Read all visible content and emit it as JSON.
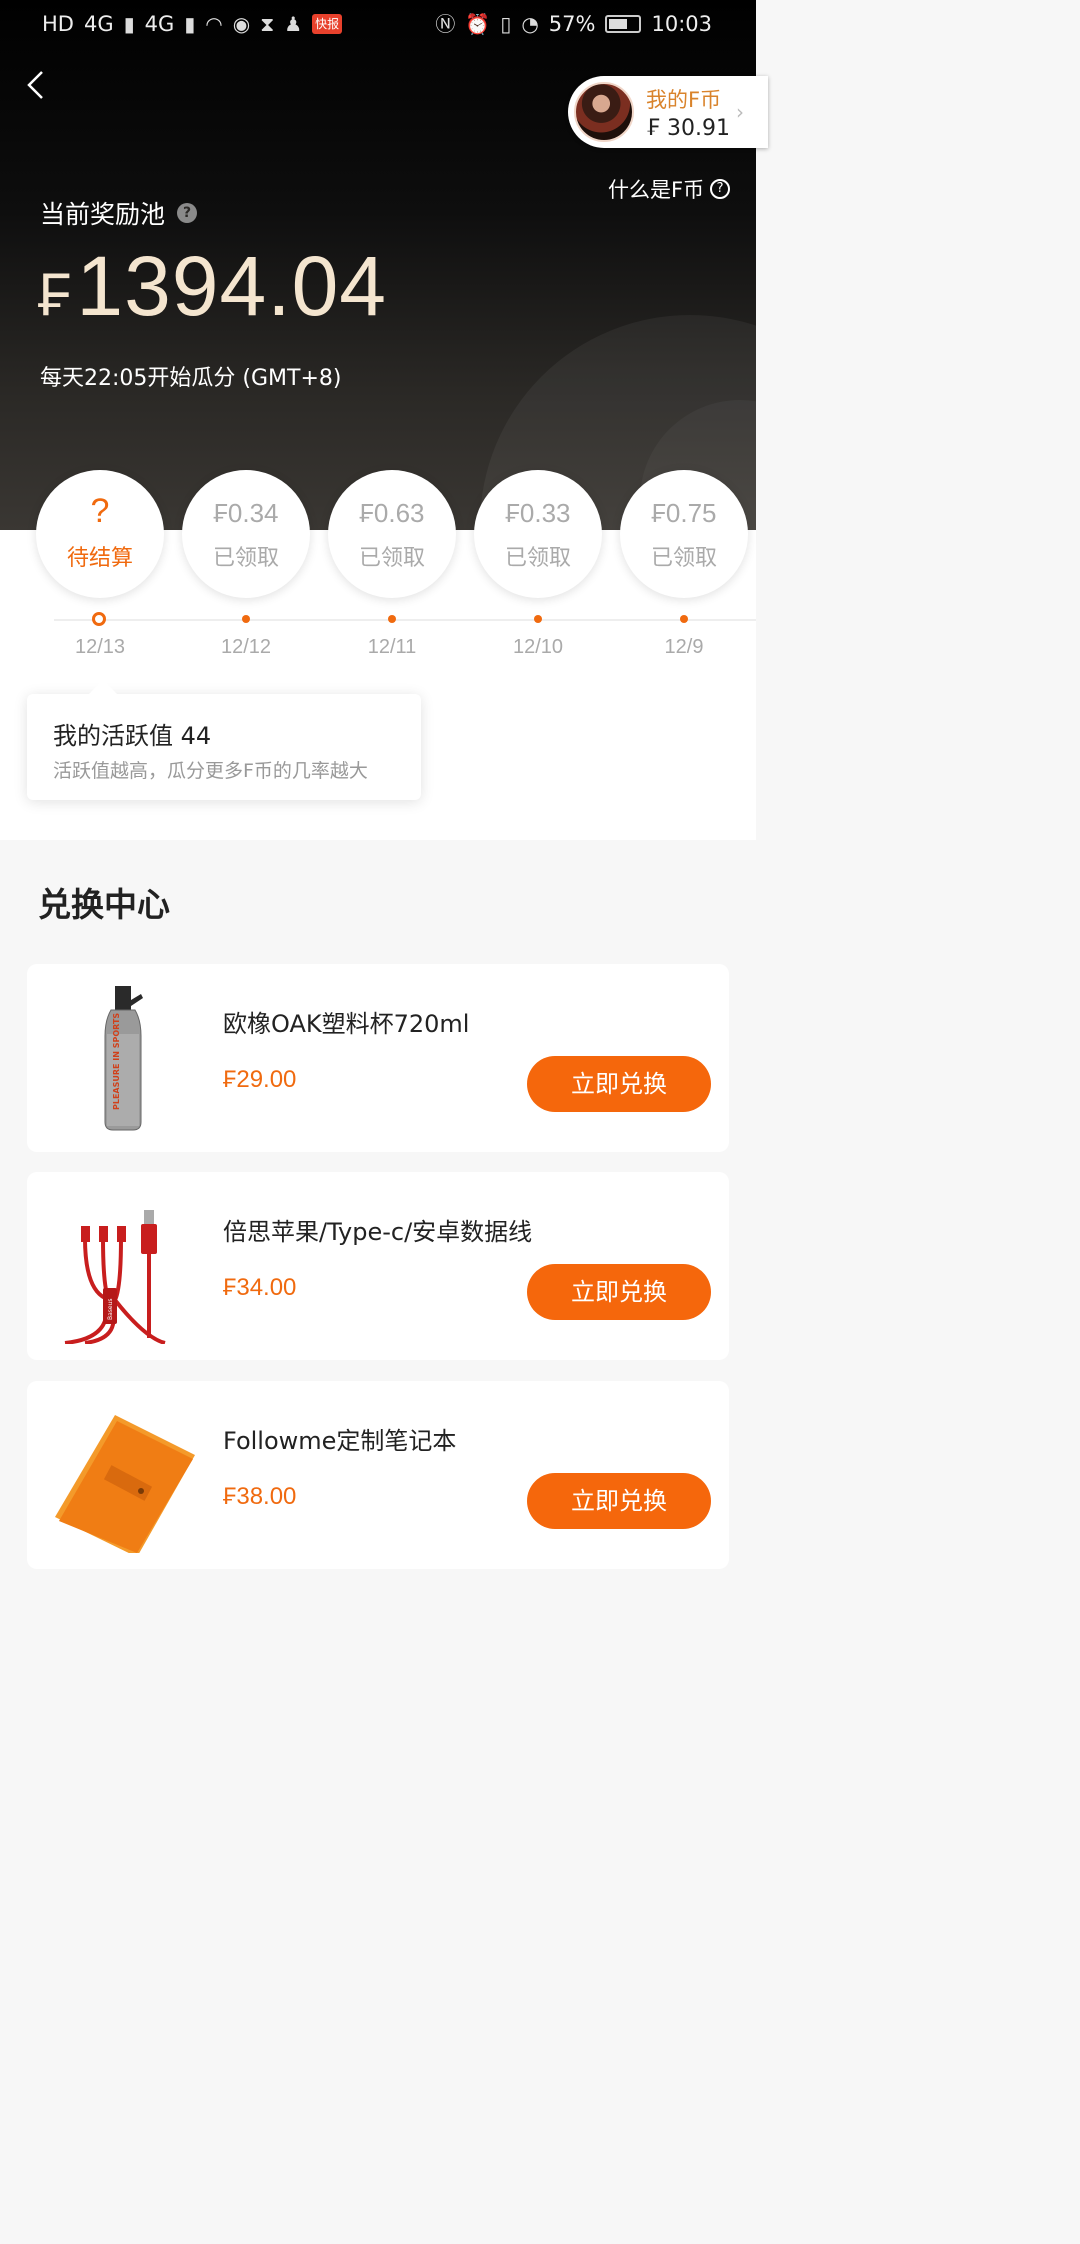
{
  "status_bar": {
    "left_labels": [
      "HD",
      "4G",
      "4G"
    ],
    "kuaibao": "快报",
    "battery": "57%",
    "time": "10:03"
  },
  "header": {
    "back_icon": "chevron-left-icon",
    "fcoin_title": "我的F币",
    "fcoin_value": "₣ 30.91",
    "what_f": "什么是F币"
  },
  "pool": {
    "label": "当前奖励池",
    "currency": "₣",
    "amount": "1394.04",
    "time_text": "每天22:05开始瓜分 (GMT+8)"
  },
  "days": [
    {
      "amount": "?",
      "status": "待结算",
      "date": "12/13",
      "pending": true
    },
    {
      "amount": "₣0.34",
      "status": "已领取",
      "date": "12/12",
      "pending": false
    },
    {
      "amount": "₣0.63",
      "status": "已领取",
      "date": "12/11",
      "pending": false
    },
    {
      "amount": "₣0.33",
      "status": "已领取",
      "date": "12/10",
      "pending": false
    },
    {
      "amount": "₣0.75",
      "status": "已领取",
      "date": "12/9",
      "pending": false
    }
  ],
  "tooltip": {
    "title": "我的活跃值 44",
    "subtitle": "活跃值越高，瓜分更多F币的几率越大"
  },
  "exchange": {
    "title": "兑换中心",
    "button_label": "立即兑换",
    "items": [
      {
        "name": "欧橡OAK塑料杯720ml",
        "price": "₣29.00",
        "image": "water-bottle",
        "bottle_text": "PLEASURE IN SPORTS"
      },
      {
        "name": "倍思苹果/Type-c/安卓数据线",
        "price": "₣34.00",
        "image": "usb-cable",
        "brand_text": "Baseus"
      },
      {
        "name": "Followme定制笔记本",
        "price": "₣38.00",
        "image": "notebook"
      }
    ]
  },
  "colors": {
    "accent": "#f5670c",
    "gold": "#d9832b",
    "pool_amount": "#f4e5cf"
  }
}
